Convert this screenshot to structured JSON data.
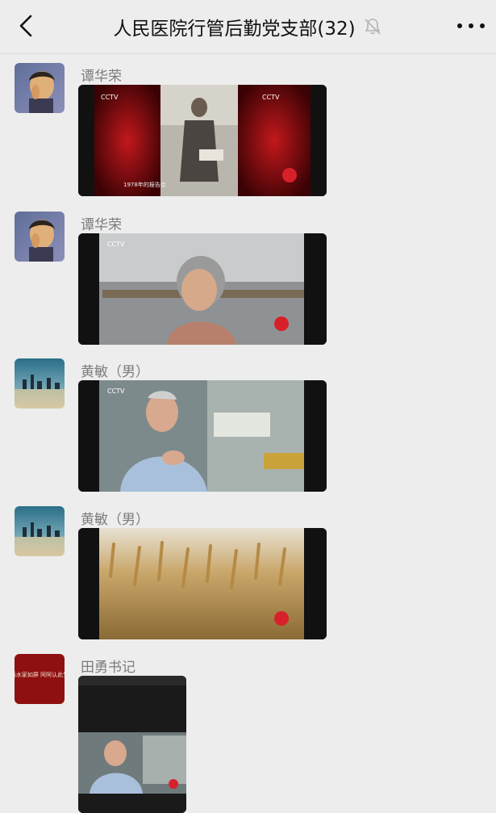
{
  "header": {
    "title": "人民医院行管后勤党支部(32)"
  },
  "messages": [
    {
      "sender": "谭华荣",
      "type": "video",
      "video_label": "CCTV",
      "caption": "1978年的报告会"
    },
    {
      "sender": "谭华荣",
      "type": "video",
      "video_label": "CCTV",
      "caption": ""
    },
    {
      "sender": "黄敏（男）",
      "type": "video",
      "video_label": "CCTV",
      "caption": ""
    },
    {
      "sender": "黄敏（男）",
      "type": "video",
      "video_label": "",
      "caption": ""
    },
    {
      "sender": "田勇书记",
      "type": "video",
      "video_label": "",
      "caption": ""
    }
  ],
  "avatars": {
    "tian_yong_calligraphy": "丽水家如屏 阿阿认此生"
  },
  "colors": {
    "background": "#ededed",
    "title_text": "#111111",
    "sender_text": "#7c7c7c"
  },
  "icons": [
    "back-arrow-icon",
    "mute-bell-icon",
    "more-icon"
  ]
}
